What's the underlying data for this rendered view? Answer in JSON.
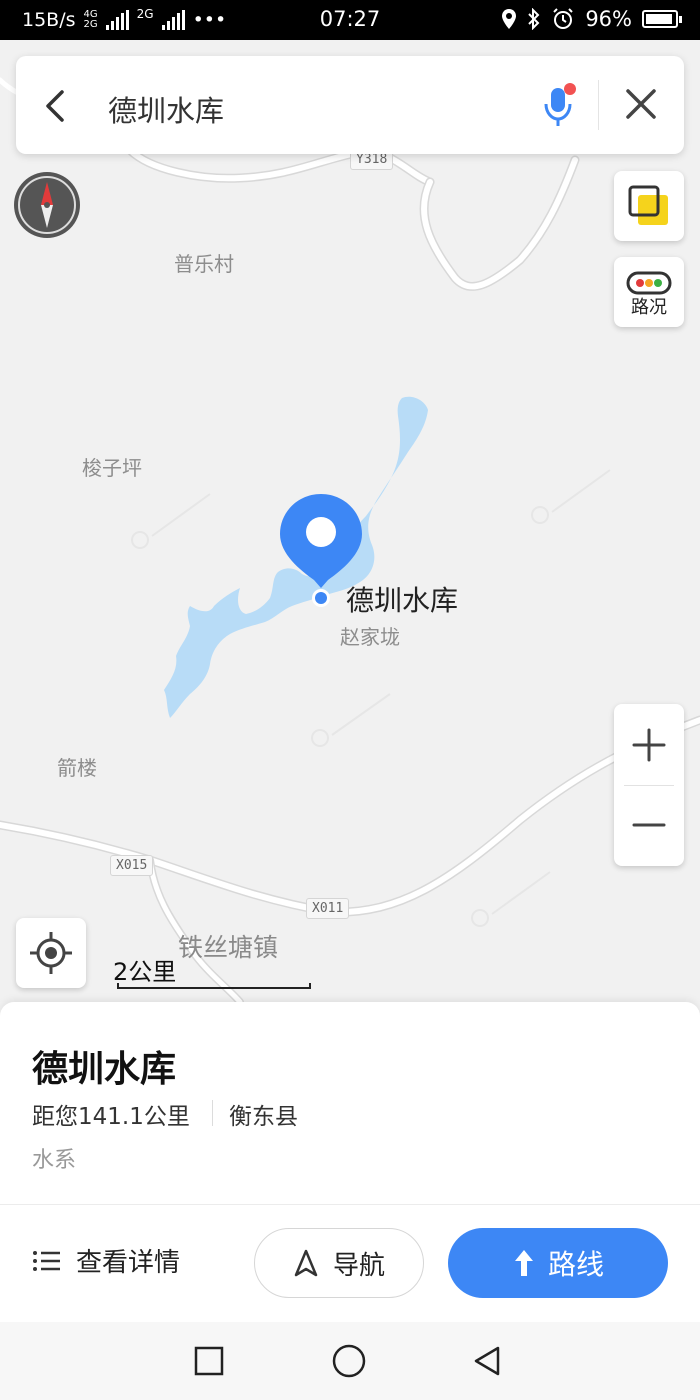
{
  "status_bar": {
    "net_speed": "15B/s",
    "sim1_tags": [
      "4G",
      "2G"
    ],
    "sim2_tag": "2G",
    "more": "•••",
    "time": "07:27",
    "battery_percent": "96%"
  },
  "search": {
    "query": "德圳水库"
  },
  "map": {
    "places": {
      "pule": "普乐村",
      "suoziping": "梭子坪",
      "zhaojialong": "赵家垅",
      "jianlou": "箭楼",
      "town": "铁丝塘镇"
    },
    "roads": {
      "y318": "Y318",
      "x015": "X015",
      "x011": "X011"
    },
    "marker_label": "德圳水库",
    "scale_label": "2公里",
    "traffic_label": "路况",
    "colors": {
      "water": "#b8dcf7",
      "pin": "#3d87f5",
      "road": "#ffffff"
    }
  },
  "poi": {
    "name": "德圳水库",
    "distance": "距您141.1公里",
    "county": "衡东县",
    "category": "水系"
  },
  "actions": {
    "details": "查看详情",
    "navigate": "导航",
    "route": "路线",
    "route_color": "#3d87f5"
  }
}
